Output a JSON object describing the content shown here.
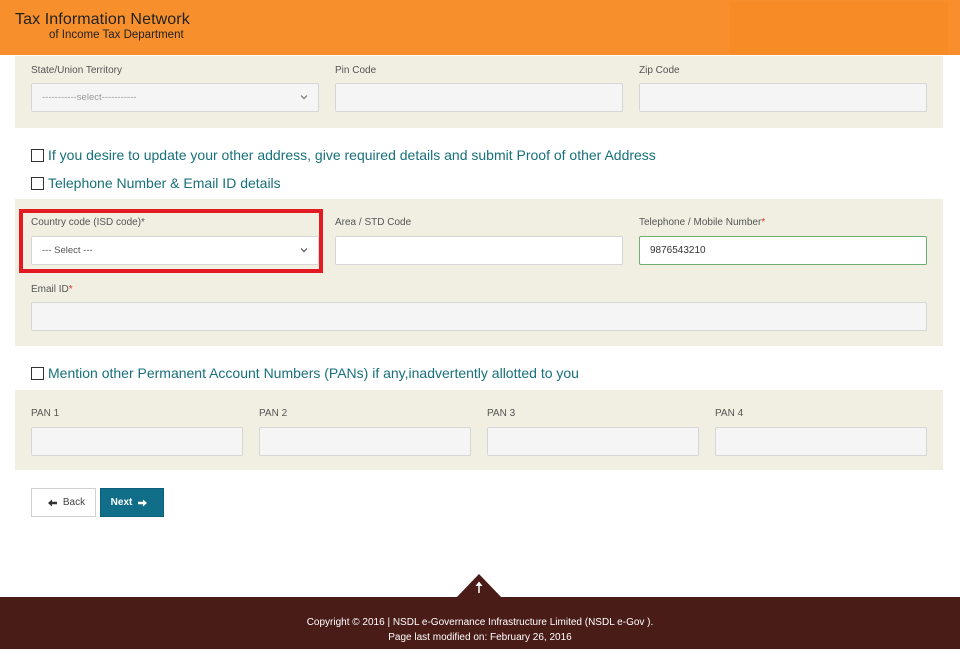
{
  "header": {
    "title": "Tax Information Network",
    "subtitle": "of Income Tax Department"
  },
  "address": {
    "state_label": "State/Union Territory",
    "state_value": "-----------select-----------",
    "pin_label": "Pin Code",
    "pin_value": "",
    "zip_label": "Zip Code",
    "zip_value": ""
  },
  "checkboxes": {
    "other_address": "If you desire to update your other address, give required details and submit Proof of other Address",
    "telephone_email": "Telephone Number & Email ID details",
    "other_pans": "Mention other Permanent Account Numbers (PANs) if any,inadvertently allotted to you"
  },
  "contact": {
    "country_label": "Country code (ISD code)*",
    "country_value": "--- Select ---",
    "area_label": "Area / STD Code",
    "area_value": "",
    "phone_label": "Telephone / Mobile Number",
    "phone_required": "*",
    "phone_value": "9876543210",
    "email_label": "Email ID",
    "email_required": "*",
    "email_value": ""
  },
  "pans": {
    "labels": [
      "PAN 1",
      "PAN 2",
      "PAN 3",
      "PAN 4"
    ],
    "values": [
      "",
      "",
      "",
      ""
    ]
  },
  "buttons": {
    "back": "Back",
    "next": "Next"
  },
  "footer": {
    "copyright": "Copyright © 2016 | NSDL e-Governance Infrastructure Limited (NSDL e-Gov ).",
    "modified": "Page last modified on: February 26, 2016"
  },
  "colors": {
    "header": "#f7902c",
    "panel": "#f0efe2",
    "accent": "#106e89",
    "highlight": "#e21b23",
    "footer": "#4a1c18"
  }
}
